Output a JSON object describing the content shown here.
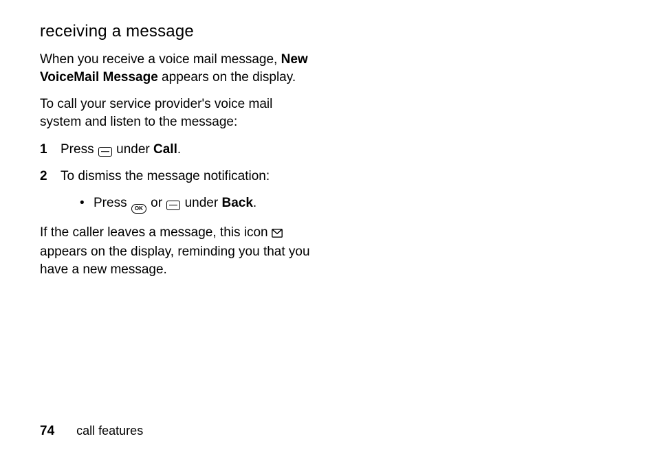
{
  "heading": "receiving a message",
  "para1_a": "When you receive a voice mail message, ",
  "para1_bold": "New VoiceMail Message",
  "para1_b": " appears on the display.",
  "para2": "To call your service provider's voice mail system and listen to the message:",
  "step1_a": "Press ",
  "step1_b": " under ",
  "step1_bold": "Call",
  "step1_c": ".",
  "step2": "To dismiss the message notification:",
  "sub1_a": "Press ",
  "sub1_b": " or ",
  "sub1_c": " under ",
  "sub1_bold": "Back",
  "sub1_d": ".",
  "para3_a": "If the caller leaves a message, this icon ",
  "para3_b": " appears on the display, reminding you that you have a new message.",
  "footer_page": "74",
  "footer_section": "call features",
  "icons": {
    "softkey": "softkey-icon",
    "ok": "ok-icon",
    "mail": "mail-icon"
  }
}
